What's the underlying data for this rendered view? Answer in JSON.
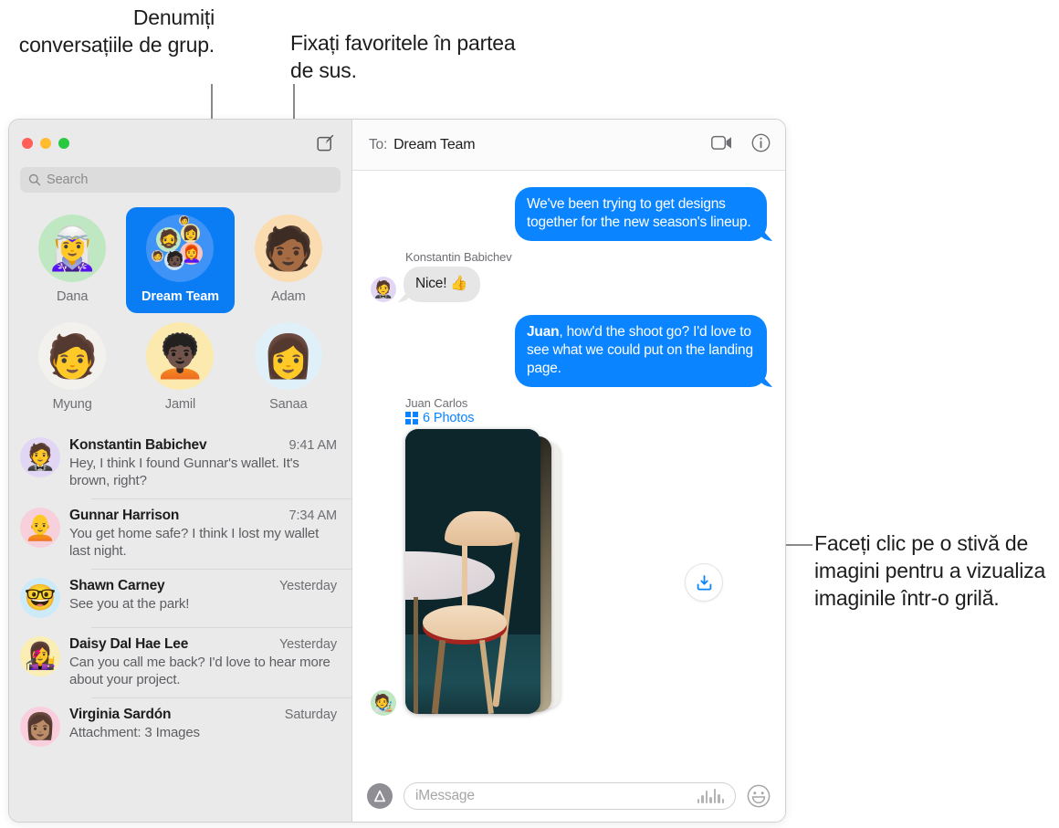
{
  "callouts": {
    "group_name": "Denumiți conversațiile de grup.",
    "pin_top": "Fixați favoritele în partea de sus.",
    "photo_stack": "Faceți clic pe o stivă de imagini pentru a vizualiza imaginile într-o grilă."
  },
  "sidebar": {
    "compose_icon": "compose-icon",
    "search": {
      "placeholder": "Search",
      "icon": "search-icon"
    },
    "pinned": [
      {
        "label": "Dana",
        "avatar": "🧝‍♀️",
        "bg": "#bfe8c2",
        "selected": false
      },
      {
        "label": "Dream Team",
        "avatar": "group",
        "bg": "#0a7cf4",
        "selected": true
      },
      {
        "label": "Adam",
        "avatar": "🧑🏾",
        "bg": "#fadcb0",
        "selected": false
      },
      {
        "label": "Myung",
        "avatar": "🧑",
        "bg": "#f3f1ee",
        "selected": false
      },
      {
        "label": "Jamil",
        "avatar": "🧑🏿‍🦱",
        "bg": "#fbe9ae",
        "selected": false
      },
      {
        "label": "Sanaa",
        "avatar": "👩",
        "bg": "#dff0f8",
        "selected": false
      }
    ],
    "conversations": [
      {
        "name": "Konstantin Babichev",
        "time": "9:41 AM",
        "snippet": "Hey, I think I found Gunnar's wallet. It's brown, right?",
        "avatar": "🤵",
        "bg": "#e2d6f5"
      },
      {
        "name": "Gunnar Harrison",
        "time": "7:34 AM",
        "snippet": "You get home safe? I think I lost my wallet last night.",
        "avatar": "🧑‍🦲",
        "bg": "#f8d0dc"
      },
      {
        "name": "Shawn Carney",
        "time": "Yesterday",
        "snippet": "See you at the park!",
        "avatar": "🤓",
        "bg": "#cdeaf8"
      },
      {
        "name": "Daisy Dal Hae Lee",
        "time": "Yesterday",
        "snippet": "Can you call me back? I'd love to hear more about your project.",
        "avatar": "👩‍🎤",
        "bg": "#fbeeb4"
      },
      {
        "name": "Virginia Sardón",
        "time": "Saturday",
        "snippet": "Attachment: 3 Images",
        "avatar": "👩🏽",
        "bg": "#f9cfdd"
      }
    ]
  },
  "pane": {
    "to_label": "To:",
    "to_value": "Dream Team",
    "facetime_icon": "video-camera-icon",
    "info_icon": "info-circle-icon",
    "messages": [
      {
        "direction": "out",
        "text": "We've been trying to get designs together for the new season's lineup."
      },
      {
        "direction": "in",
        "sender": "Konstantin Babichev",
        "text": "Nice!  👍",
        "avatar": "🤵",
        "avatar_bg": "#e2d6f5"
      },
      {
        "direction": "out",
        "bold_prefix": "Juan",
        "text": ", how'd the shoot go? I'd love to see what we could put on the landing page."
      }
    ],
    "attachment": {
      "sender": "Juan Carlos",
      "count_label": "6 Photos",
      "grid_icon": "photo-grid-icon",
      "download_icon": "download-icon",
      "avatar": "🧑‍🎨",
      "avatar_bg": "#bfe8c2"
    },
    "composer": {
      "apps_icon": "app-store-icon",
      "placeholder": "iMessage",
      "audio_icon": "audio-waveform-icon",
      "emoji_icon": "smiley-icon"
    }
  },
  "colors": {
    "accent_blue": "#0a84ff",
    "selected_pin_blue": "#0a7cf4",
    "incoming_gray": "#e6e6e6",
    "sidebar_bg": "#eaeaea"
  }
}
